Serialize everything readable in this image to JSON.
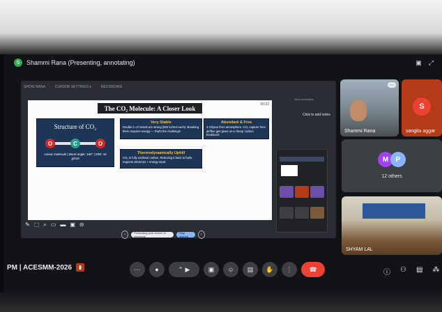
{
  "presenter": {
    "avatar_letter": "S",
    "label": "Shammi Rana (Presenting, annotating)"
  },
  "share_toolbar": [
    "SHOW RANA",
    "CURSOR SETTINGS ▾",
    "RECORDING"
  ],
  "slide": {
    "title": "The CO₂ Molecule: A Closer Look",
    "time": "00:32",
    "structure": {
      "title": "Structure of CO₂",
      "atoms": [
        "O",
        "C",
        "O"
      ],
      "desc": "Linear molecule | Bond angle: 180° | MW: 44 g/mol"
    },
    "boxes": [
      {
        "title": "Very Stable",
        "body": "Double C=O bonds are strong (803 kJ/mol each). Breaking them requires energy — that's the challenge!"
      },
      {
        "title": "Abundant & Free",
        "body": "4 Gt/year from atmosphere. CO₂ capture from air/flue gas gives us a cheap 'carbon feedstock'."
      },
      {
        "title": "Thermodynamically Uphill",
        "body": "CO₂ is fully oxidised carbon. Reducing it back to fuels requires electrons + energy input."
      }
    ]
  },
  "notes": {
    "label": "Next annotation",
    "hint": "Click to add notes"
  },
  "page_nav": {
    "pill_left": "Presenting your screen to everyone",
    "pill_blue": "Stop sharing"
  },
  "participants": {
    "shammi": {
      "name": "Shammi Rana"
    },
    "sangita": {
      "initial": "S",
      "name": "sangita aggar"
    },
    "others": {
      "initials": [
        "M",
        "P"
      ],
      "label": "12 others"
    },
    "shyam": {
      "name": "SHYAM LAL"
    }
  },
  "meeting": {
    "time_code": "PM | ACESMM-2026"
  },
  "colors": {
    "mic": "#3c4043",
    "end_call": "#ea4335",
    "sangita_tile": "#b33b18",
    "avatar_m": "#a142f4",
    "avatar_p": "#8ab4f8"
  }
}
